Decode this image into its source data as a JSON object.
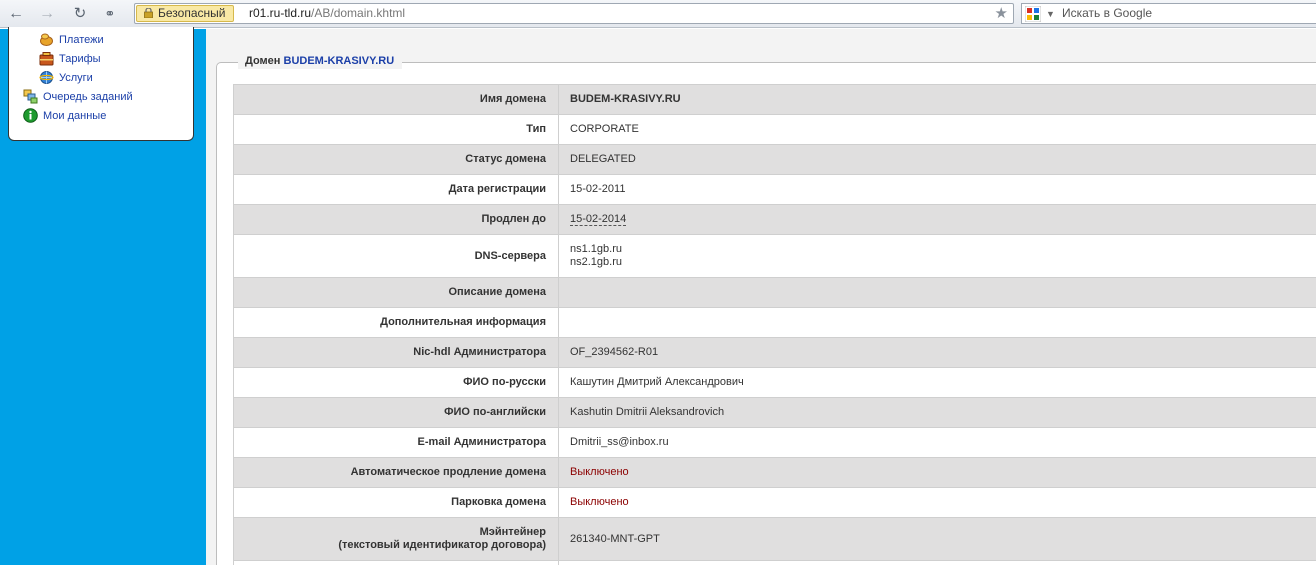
{
  "browser": {
    "security_label": "Безопасный",
    "url_host": "r01.ru-tld.ru",
    "url_path": "/AB/domain.khtml",
    "search_placeholder": "Искать в Google"
  },
  "sidebar": {
    "items": [
      {
        "label": "Платежи",
        "icon": "payments-icon"
      },
      {
        "label": "Тарифы",
        "icon": "tariffs-icon"
      },
      {
        "label": "Услуги",
        "icon": "services-icon"
      },
      {
        "label": "Очередь заданий",
        "icon": "task-queue-icon"
      },
      {
        "label": "Мои данные",
        "icon": "info-icon"
      }
    ]
  },
  "domain_panel": {
    "legend_prefix": "Домен",
    "legend_domain": "BUDEM-KRASIVY.RU",
    "rows": [
      {
        "label": "Имя домена",
        "value": "BUDEM-KRASIVY.RU"
      },
      {
        "label": "Тип",
        "value": "CORPORATE"
      },
      {
        "label": "Статус домена",
        "value": "DELEGATED"
      },
      {
        "label": "Дата регистрации",
        "value": "15-02-2011"
      },
      {
        "label": "Продлен до",
        "value": "15-02-2014"
      },
      {
        "label": "DNS-сервера",
        "value_line1": "ns1.1gb.ru",
        "value_line2": "ns2.1gb.ru"
      },
      {
        "label": "Описание домена",
        "value": ""
      },
      {
        "label": "Дополнительная информация",
        "value": ""
      },
      {
        "label": "Nic-hdl Администратора",
        "value": "OF_2394562-R01"
      },
      {
        "label": "ФИО по-русски",
        "value": "Кашутин Дмитрий Александрович"
      },
      {
        "label": "ФИО по-английски",
        "value": "Kashutin Dmitrii Aleksandrovich"
      },
      {
        "label": "E-mail Администратора",
        "value": "Dmitrii_ss@inbox.ru"
      },
      {
        "label": "Автоматическое продление домена",
        "value": "Выключено"
      },
      {
        "label": "Парковка домена",
        "value": "Выключено"
      },
      {
        "label_line1": "Мэйнтейнер",
        "label_line2": "(текстовый идентификатор договора)",
        "value": "261340-MNT-GPT"
      }
    ]
  },
  "colors": {
    "sidebar_bg": "#00a1e6",
    "link": "#1b3fa8",
    "off_status": "#8b0000",
    "row_shaded": "#e0dfdf"
  }
}
